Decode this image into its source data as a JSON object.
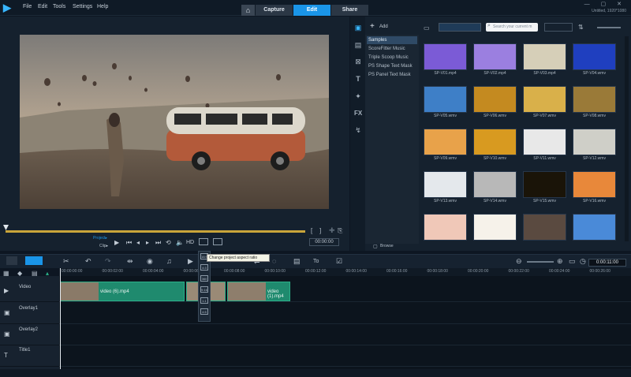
{
  "menu": [
    "File",
    "Edit",
    "Tools",
    "Settings",
    "Help"
  ],
  "workspace_tabs": [
    "Capture",
    "Edit",
    "Share"
  ],
  "window_title": "Untitled, 1920*1080",
  "window_controls": "— ▢ ✕",
  "player": {
    "mode_project": "Project▸",
    "mode_clip": "Clip▸",
    "hd_label": "HD",
    "timecode": "00:00:00"
  },
  "library": {
    "add_label": "Add",
    "folders": [
      "Samples",
      "ScoreFitter Music",
      "Triple Scoop Music",
      "PS Shape Text Mask",
      "PS Panel Text Mask"
    ],
    "search_placeholder": "Search your current m",
    "browse_label": "Browse",
    "thumbnails": [
      {
        "label": "SP-V01.mp4",
        "color": "#7b5bd6"
      },
      {
        "label": "SP-V02.mp4",
        "color": "#9b7fe0"
      },
      {
        "label": "SP-V03.mp4",
        "color": "#d6cfb8"
      },
      {
        "label": "SP-V04.wmv",
        "color": "#1f3fbf"
      },
      {
        "label": "SP-V05.wmv",
        "color": "#3e7fc7"
      },
      {
        "label": "SP-V06.wmv",
        "color": "#c48a20"
      },
      {
        "label": "SP-V07.wmv",
        "color": "#d9b04a"
      },
      {
        "label": "SP-V08.wmv",
        "color": "#9a7a38"
      },
      {
        "label": "SP-V09.wmv",
        "color": "#e8a24a"
      },
      {
        "label": "SP-V10.wmv",
        "color": "#d89a20"
      },
      {
        "label": "SP-V11.wmv",
        "color": "#e8e8e8"
      },
      {
        "label": "SP-V12.wmv",
        "color": "#cfcfc8"
      },
      {
        "label": "SP-V13.wmv",
        "color": "#e4e8ec"
      },
      {
        "label": "SP-V14.wmv",
        "color": "#b8b8b8"
      },
      {
        "label": "SP-V15.wmv",
        "color": "#1a1408"
      },
      {
        "label": "SP-V16.wmv",
        "color": "#e8883a"
      },
      {
        "label": "",
        "color": "#f0c8b8"
      },
      {
        "label": "",
        "color": "#f6f2ea"
      },
      {
        "label": "",
        "color": "#5a4a40"
      },
      {
        "label": "",
        "color": "#4a8ad8"
      }
    ]
  },
  "timeline": {
    "ticks": [
      "00:00:00:00",
      "00:00:02:00",
      "00:00:04:00",
      "00:00:06:00",
      "00:00:08:00",
      "00:00:10:00",
      "00:00:12:00",
      "00:00:14:00",
      "00:00:16:00",
      "00:00:18:00",
      "00:00:20:00",
      "00:00:22:00",
      "00:00:24:00",
      "00:00:26:00"
    ],
    "tracks": [
      "Video",
      "Overlay1",
      "Overlay2",
      "Title1"
    ],
    "clips": [
      "video (6).mp4",
      "video (1).mp4"
    ],
    "timecode": "0:00:11:00"
  },
  "aspect_menu": {
    "tooltip": "Change project aspect ratio",
    "options": [
      "16:9",
      "4:3",
      "360",
      "9:16",
      "1:1",
      "4:5"
    ]
  }
}
